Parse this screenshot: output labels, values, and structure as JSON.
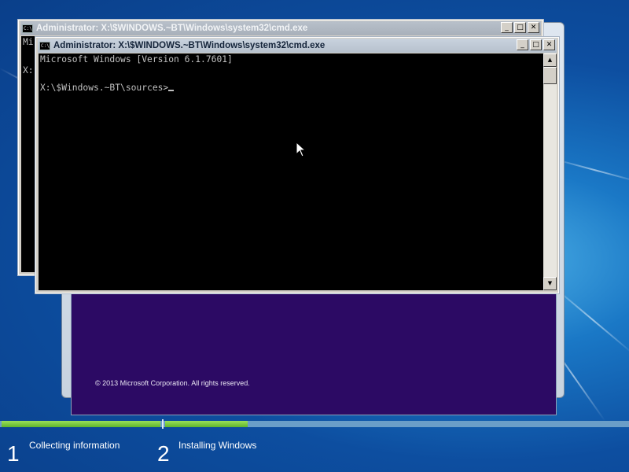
{
  "background_window": {
    "title": "Administrator: X:\\$WINDOWS.~BT\\Windows\\system32\\cmd.exe",
    "console_lines": [
      "Mi",
      "",
      "X:"
    ]
  },
  "active_window": {
    "title": "Administrator: X:\\$WINDOWS.~BT\\Windows\\system32\\cmd.exe",
    "console_lines": [
      "Microsoft Windows [Version 6.1.7601]",
      "",
      "X:\\$Windows.~BT\\sources>"
    ]
  },
  "title_buttons": {
    "minimize": "_",
    "maximize": "□",
    "close": "✕"
  },
  "setup": {
    "copyright": "© 2013 Microsoft Corporation. All rights reserved."
  },
  "progress": {
    "steps": [
      {
        "number": "1",
        "label": "Collecting information"
      },
      {
        "number": "2",
        "label": "Installing Windows"
      }
    ],
    "step1_fraction": 1.0,
    "step2_fraction": 0.18
  },
  "colors": {
    "console_bg": "#000000",
    "console_text": "#c0c0c0",
    "setup_bg": "#2c0a64",
    "progress_fill": "#5fb52c"
  }
}
